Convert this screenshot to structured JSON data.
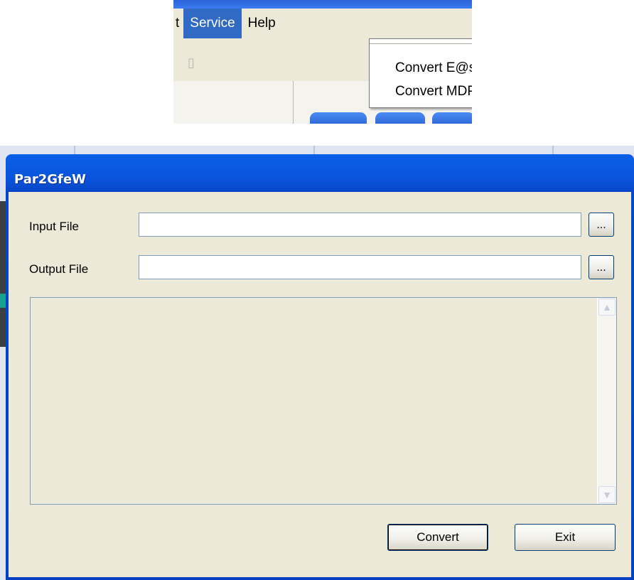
{
  "menu": {
    "items": [
      {
        "label": "t",
        "active": false
      },
      {
        "label": "Service",
        "active": true
      },
      {
        "label": "Help",
        "active": false
      }
    ],
    "dropdown": [
      "Convert E@syDrives par file",
      "Convert MDPLC par file"
    ]
  },
  "window": {
    "title": "Par2GfeW",
    "input_label": "Input File",
    "input_value": "",
    "output_label": "Output File",
    "output_value": "",
    "browse_label": "...",
    "log_text": "",
    "convert_label": "Convert",
    "exit_label": "Exit"
  },
  "icons": {
    "scroll_up": "scroll-up-arrow-icon",
    "scroll_down": "scroll-down-arrow-icon"
  },
  "colors": {
    "menu_highlight": "#316ac5",
    "title_bar": "#0a54dc",
    "dialog_face": "#ece9d8"
  }
}
